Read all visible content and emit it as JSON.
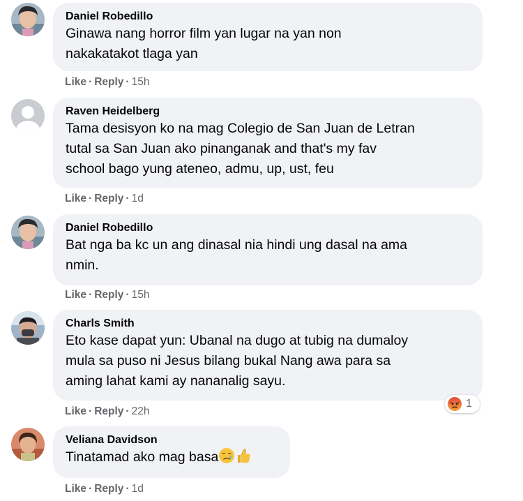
{
  "comments": [
    {
      "author": "Daniel Robedillo",
      "text": "Ginawa nang horror film yan lugar na yan non\nnakakatakot tlaga yan",
      "like": "Like",
      "reply": "Reply",
      "time": "15h",
      "avatar": "daniel-avatar"
    },
    {
      "author": "Raven Heidelberg",
      "text": "Tama desisyon ko na mag Colegio de San Juan de Letran\ntutal sa San Juan ako pinanganak and that's my fav\nschool bago yung ateneo, admu, up, ust, feu",
      "like": "Like",
      "reply": "Reply",
      "time": "1d",
      "avatar": "default-avatar"
    },
    {
      "author": "Daniel Robedillo",
      "text": "Bat nga ba kc un ang dinasal nia hindi ung dasal na ama\nnmin.",
      "like": "Like",
      "reply": "Reply",
      "time": "15h",
      "avatar": "daniel-avatar"
    },
    {
      "author": "Charls Smith",
      "text": "Eto kase dapat yun: Ubanal na dugo at tubig na dumaloy\nmula sa puso ni Jesus bilang bukal Nang awa para sa\naming lahat kami ay nananalig sayu.",
      "like": "Like",
      "reply": "Reply",
      "time": "22h",
      "avatar": "charls-avatar",
      "reaction": {
        "icon": "angry-reaction-icon",
        "count": "1"
      }
    },
    {
      "author": "Veliana Davidson",
      "text": "Tinatamad ako mag basa",
      "emojis": [
        "crying-face-icon",
        "thumbs-up-icon"
      ],
      "like": "Like",
      "reply": "Reply",
      "time": "1d",
      "avatar": "veliana-avatar"
    }
  ],
  "separator": "·",
  "colors": {
    "bubble": "#f0f2f5",
    "meta": "#65676b",
    "text": "#050505",
    "angry": "#e9710f"
  }
}
